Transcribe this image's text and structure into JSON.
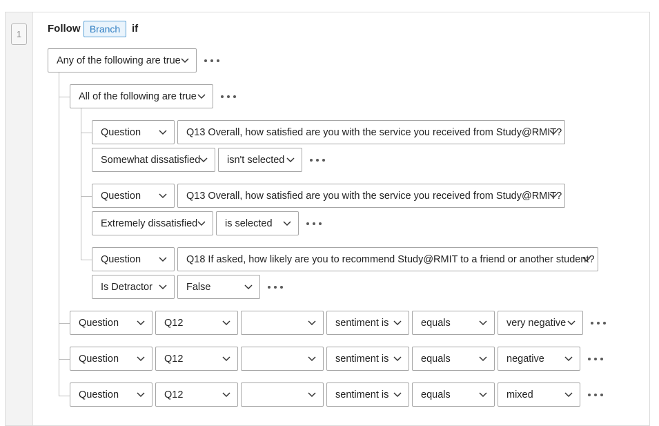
{
  "block": {
    "number": "1",
    "follow_label": "Follow",
    "branch_label": "Branch",
    "if_label": "if"
  },
  "root_group": {
    "label": "Any of the following are true"
  },
  "nested_group": {
    "label": "All of the following are true",
    "conditions": [
      {
        "type": "Question",
        "question": "Q13 Overall, how satisfied are you with the service you received from Study@RMIT?",
        "choice": "Somewhat dissatisfied",
        "operator": "isn't selected"
      },
      {
        "type": "Question",
        "question": "Q13 Overall, how satisfied are you with the service you received from Study@RMIT?",
        "choice": "Extremely dissatisfied",
        "operator": "is selected"
      },
      {
        "type": "Question",
        "question": "Q18 If asked, how likely are you to recommend Study@RMIT to a friend or another student?",
        "choice": "Is Detractor",
        "operator": "False"
      }
    ]
  },
  "sentiment_conditions": [
    {
      "type": "Question",
      "question": "Q12",
      "field": "",
      "metric": "sentiment is",
      "operator": "equals",
      "value": "very negative"
    },
    {
      "type": "Question",
      "question": "Q12",
      "field": "",
      "metric": "sentiment is",
      "operator": "equals",
      "value": "negative"
    },
    {
      "type": "Question",
      "question": "Q12",
      "field": "",
      "metric": "sentiment is",
      "operator": "equals",
      "value": "mixed"
    }
  ],
  "icons": {
    "dropdown": "chevron-down-icon",
    "options": "more-options-icon"
  },
  "colors": {
    "branch_border": "#5aa1d6",
    "branch_text": "#2f7ec2",
    "control_border": "#a6a6a6"
  }
}
